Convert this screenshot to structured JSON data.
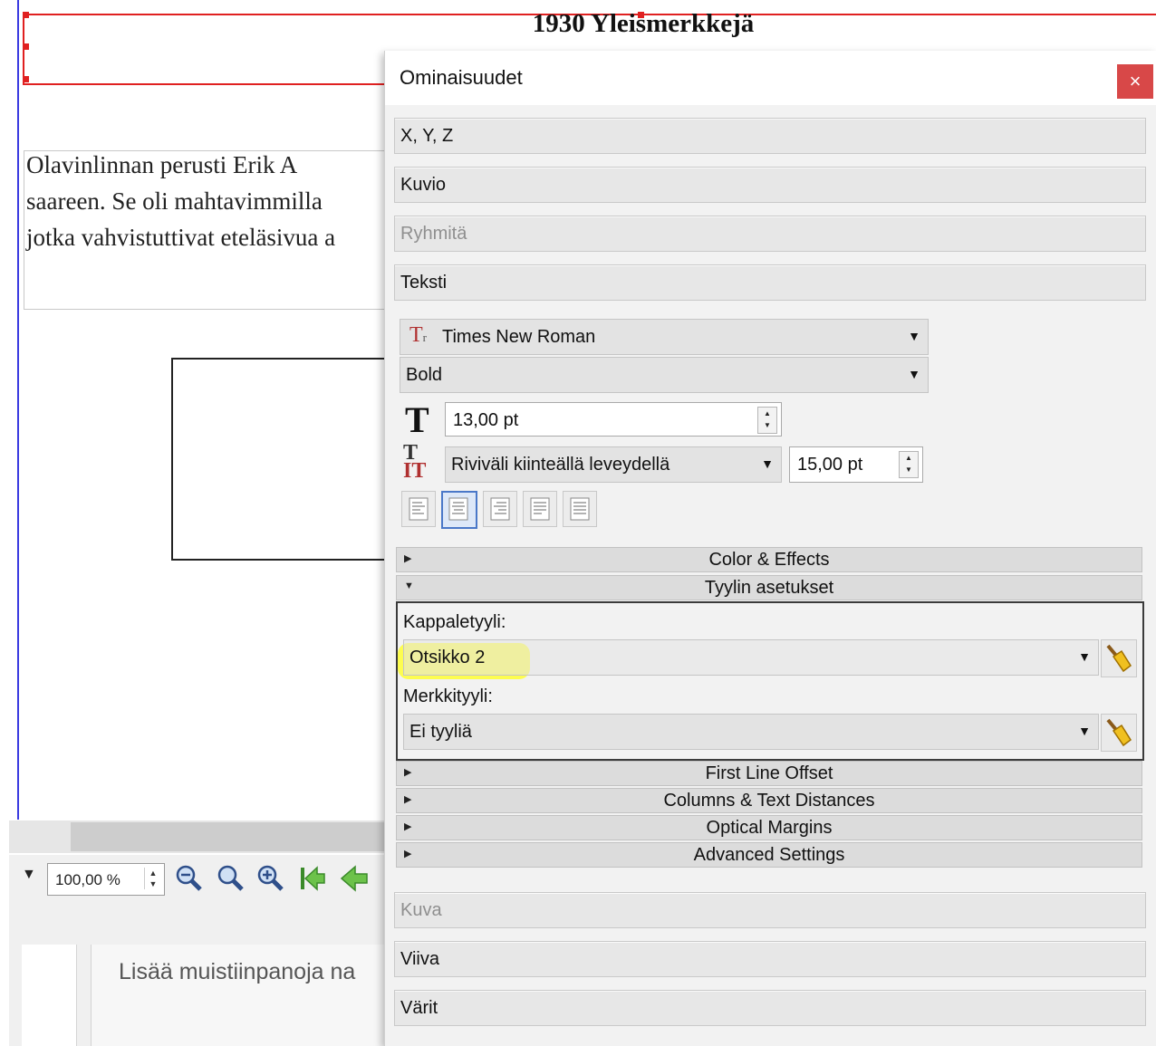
{
  "document": {
    "heading": "1930 Yleismerkkejä",
    "body_lines": [
      "Olavinlinnan  perusti  Erik  A",
      "saareen. Se oli mahtavimmilla",
      "jotka vahvistuttivat eteläsivua a"
    ],
    "zoom": "100,00 %",
    "notes_placeholder": "Lisää muistiinpanoja na"
  },
  "properties": {
    "title": "Ominaisuudet",
    "close_label": "×",
    "sections": {
      "xyz": "X, Y, Z",
      "shape": "Kuvio",
      "group": "Ryhmitä",
      "text": "Teksti",
      "image": "Kuva",
      "line": "Viiva",
      "colors": "Värit"
    },
    "text": {
      "font_family": "Times New Roman",
      "font_style": "Bold",
      "font_size": "13,00 pt",
      "line_spacing_mode": "Riviväli kiinteällä leveydellä",
      "line_spacing_value": "15,00 pt",
      "alignment_selected": "center",
      "expanders": {
        "color_effects": "Color & Effects",
        "style_settings": "Tyylin asetukset",
        "first_line_offset": "First Line Offset",
        "columns": "Columns & Text Distances",
        "optical_margins": "Optical Margins",
        "advanced": "Advanced Settings"
      },
      "paragraph_style_label": "Kappaletyyli:",
      "paragraph_style": "Otsikko 2",
      "char_style_label": "Merkkityyli:",
      "char_style": "Ei tyyliä"
    }
  },
  "colors": {
    "frame_red": "#e02020",
    "guide_blue": "#3a3ae0",
    "close_red": "#d84848",
    "highlight_yellow": "#ffff33"
  }
}
